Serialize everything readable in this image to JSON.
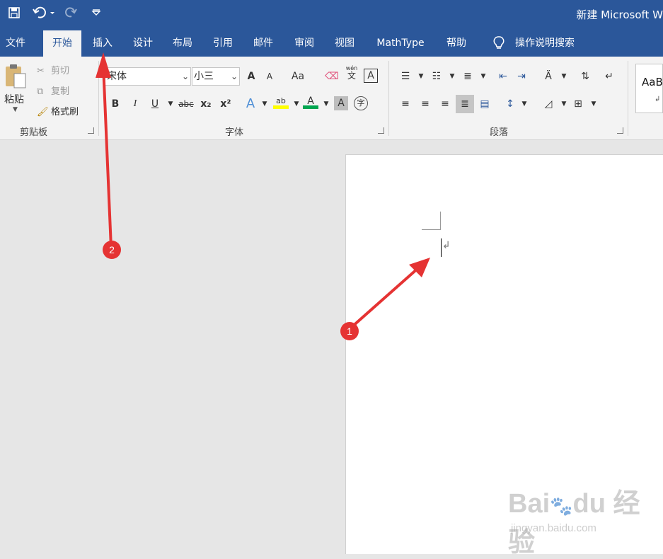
{
  "window": {
    "title": "新建 Microsoft W"
  },
  "quick_access": {
    "save_icon": "save-icon",
    "undo_icon": "undo-icon",
    "redo_icon": "redo-icon",
    "customize_icon": "customize-qat-icon"
  },
  "tabs": [
    {
      "label": "文件"
    },
    {
      "label": "开始"
    },
    {
      "label": "插入"
    },
    {
      "label": "设计"
    },
    {
      "label": "布局"
    },
    {
      "label": "引用"
    },
    {
      "label": "邮件"
    },
    {
      "label": "审阅"
    },
    {
      "label": "视图"
    },
    {
      "label": "MathType"
    },
    {
      "label": "帮助"
    }
  ],
  "tell_me": {
    "label": "操作说明搜索"
  },
  "clipboard": {
    "paste": "粘贴",
    "cut": "剪切",
    "copy": "复制",
    "format_painter": "格式刷",
    "group": "剪贴板"
  },
  "font": {
    "name": "宋体",
    "size": "小三",
    "group": "字体",
    "bold": "B",
    "italic": "I",
    "underline": "U",
    "strike": "abc",
    "subscript": "x₂",
    "superscript": "x²",
    "grow": "A",
    "shrink": "A",
    "case": "Aa",
    "phonetic": "wén",
    "phonetic_char": "文",
    "border_char": "A",
    "effects": "A",
    "highlight": "ab",
    "color": "A",
    "shading": "A",
    "enclose": "字"
  },
  "paragraph": {
    "group": "段落"
  },
  "styles": {
    "preview": "AaB"
  },
  "annotations": [
    {
      "label": "1"
    },
    {
      "label": "2"
    }
  ],
  "watermark": {
    "brand": "Bai du 经验",
    "url": "jingyan.baidu.com"
  },
  "colors": {
    "ribbon_blue": "#2b579a",
    "arrow_red": "#e53333",
    "highlight_yellow": "#ffff00",
    "font_red": "#ff0000"
  }
}
